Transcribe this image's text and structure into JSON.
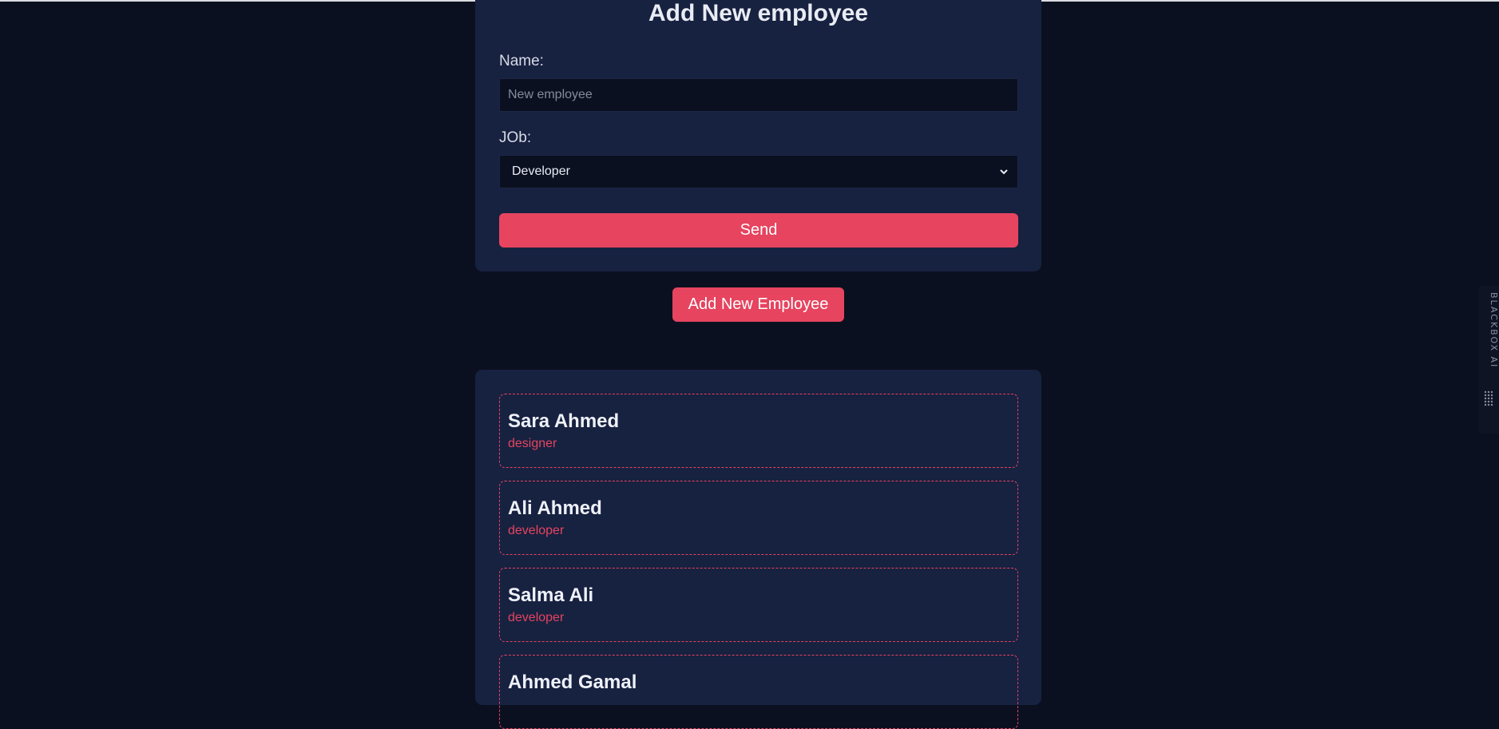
{
  "form": {
    "title": "Add New employee",
    "name_label": "Name:",
    "name_placeholder": "New employee",
    "name_value": "",
    "job_label": "JOb:",
    "job_selected": "Developer",
    "send_label": "Send"
  },
  "add_button_label": "Add New Employee",
  "employees": [
    {
      "name": "Sara Ahmed",
      "job": "designer"
    },
    {
      "name": "Ali Ahmed",
      "job": "developer"
    },
    {
      "name": "Salma Ali",
      "job": "developer"
    },
    {
      "name": "Ahmed Gamal",
      "job": ""
    }
  ],
  "side_tab": {
    "label": "BLACKBOX AI",
    "icon": "blackbox-logo-icon"
  },
  "colors": {
    "page_bg": "#0b1020",
    "card_bg": "#172140",
    "accent": "#e6445f",
    "input_bg": "#0b1020"
  }
}
